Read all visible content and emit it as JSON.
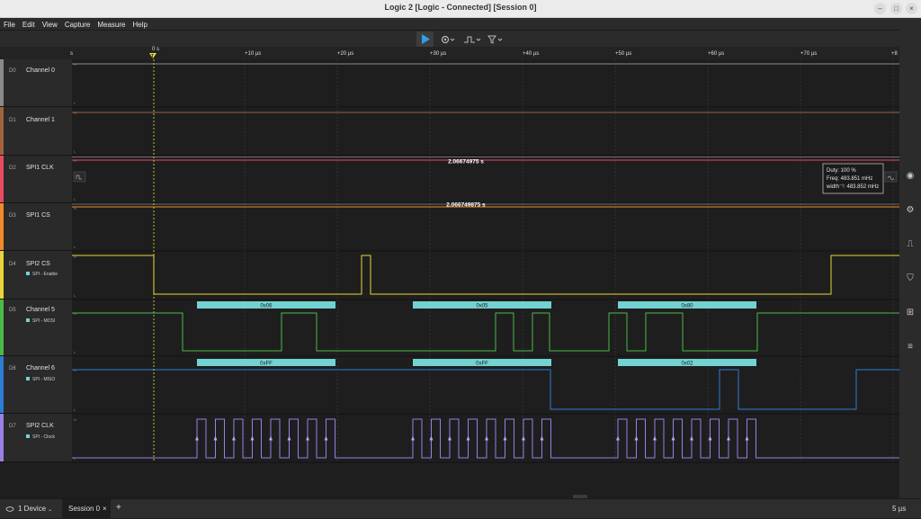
{
  "window": {
    "title": "Logic 2 [Logic - Connected] [Session 0]"
  },
  "menu": [
    "File",
    "Edit",
    "View",
    "Capture",
    "Measure",
    "Help"
  ],
  "timeline": {
    "t0_label": "0 s",
    "t_marker": "T",
    "left_label": "s",
    "ticks": [
      "+10 µs",
      "+20 µs",
      "+30 µs",
      "+40 µs",
      "+50 µs",
      "+60 µs",
      "+70 µs",
      "+8"
    ]
  },
  "channels": [
    {
      "idx": "D0",
      "name": "Channel 0",
      "color": "#8a8a8a"
    },
    {
      "idx": "D1",
      "name": "Channel 1",
      "color": "#a0633c"
    },
    {
      "idx": "D2",
      "name": "SPI1 CLK",
      "color": "#e84a5f"
    },
    {
      "idx": "D3",
      "name": "SPI1 CS",
      "color": "#f08a28"
    },
    {
      "idx": "D4",
      "name": "SPI2 CS",
      "color": "#e9d43a",
      "analyzer": "SPI - Enable"
    },
    {
      "idx": "D5",
      "name": "Channel 5",
      "color": "#4cb848",
      "analyzer": "SPI - MOSI"
    },
    {
      "idx": "D6",
      "name": "Channel 6",
      "color": "#2e7cd6",
      "analyzer": "SPI - MISO"
    },
    {
      "idx": "D7",
      "name": "SPI2 CLK",
      "color": "#9a7fe6",
      "analyzer": "SPI - Clock"
    }
  ],
  "measurements": {
    "spi1_clk_width": "2.06674975 s",
    "spi1_cs_width": "2.066749875 s"
  },
  "tooltip": {
    "duty": "Duty: 100 %",
    "freq": "Freq: 483.851 mHz",
    "width": "width⁻¹: 483.852 mHz"
  },
  "mosi_bytes": [
    "0x06",
    "0x05",
    "0x80"
  ],
  "miso_bytes": [
    "0xFF",
    "0xFF",
    "0x02"
  ],
  "status": {
    "device": "1 Device",
    "session": "Session 0",
    "close": "×",
    "add": "+",
    "scale": "5 µs"
  },
  "icons": {
    "play": "play-icon",
    "device_settings": "gear-icon",
    "right_sidebar": [
      "eye-icon",
      "gear-icon",
      "analyzer-icon",
      "trigger-icon",
      "extensions-icon",
      "notes-icon"
    ]
  }
}
